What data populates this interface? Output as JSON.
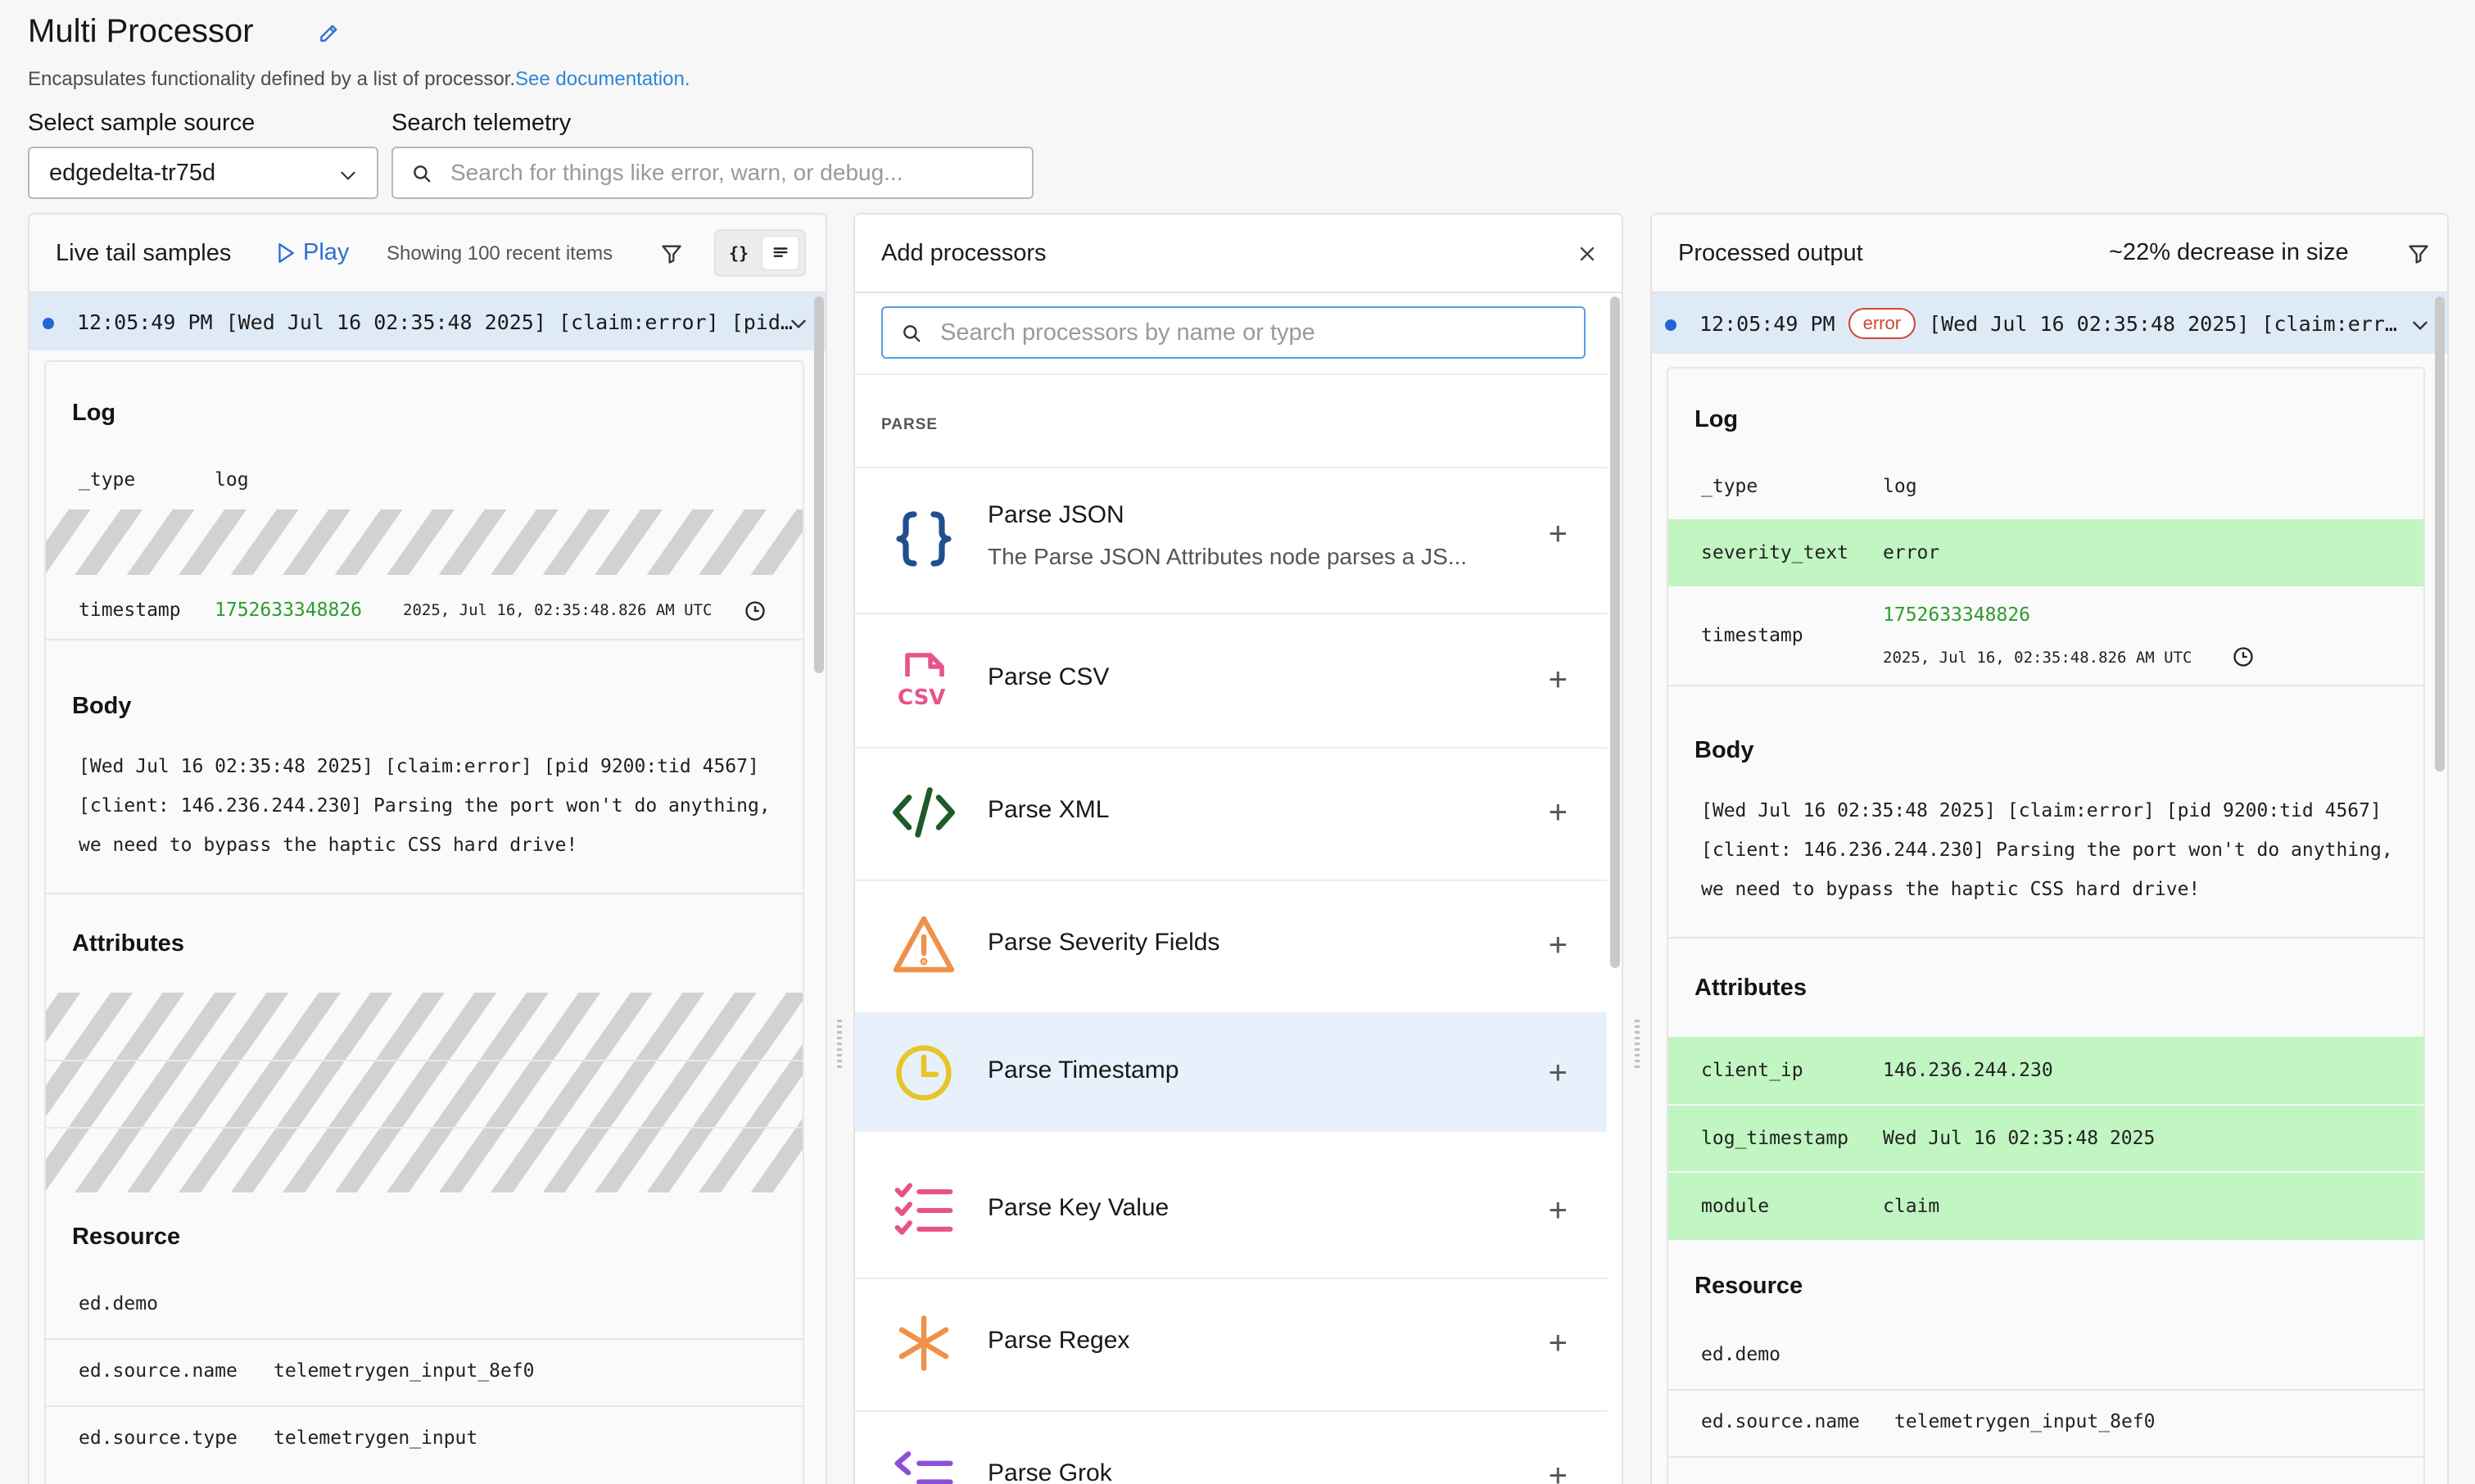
{
  "header": {
    "title": "Multi Processor",
    "description": "Encapsulates functionality defined by a list of processor.",
    "doc_link": "See documentation.",
    "sample_source_label": "Select sample source",
    "sample_source_value": "edgedelta-tr75d",
    "search_label": "Search telemetry",
    "search_placeholder": "Search for things like error, warn, or debug..."
  },
  "left": {
    "title": "Live tail samples",
    "play": "Play",
    "showing": "Showing 100 recent items",
    "json_toggle": "{}",
    "sample": {
      "time": "12:05:49 PM",
      "summary": "[Wed Jul 16 02:35:48 2025] [claim:error] [pid…"
    },
    "log_title": "Log",
    "type_key": "_type",
    "type_value": "log",
    "timestamp_key": "timestamp",
    "timestamp_value": "1752633348826",
    "timestamp_human": "2025, Jul 16, 02:35:48.826 AM UTC",
    "body_title": "Body",
    "body_text": "[Wed Jul 16 02:35:48 2025] [claim:error] [pid 9200:tid 4567] [client: 146.236.244.230] Parsing the port won't do anything, we need to bypass the haptic CSS hard drive!",
    "attributes_title": "Attributes",
    "resource_title": "Resource",
    "resource": [
      {
        "key": "ed.demo",
        "value": ""
      },
      {
        "key": "ed.source.name",
        "value": "telemetrygen_input_8ef0"
      },
      {
        "key": "ed.source.type",
        "value": "telemetrygen_input"
      }
    ]
  },
  "middle": {
    "title": "Add processors",
    "search_placeholder": "Search processors by name or type",
    "section": "PARSE",
    "processors": [
      {
        "name": "Parse JSON",
        "desc": "The Parse JSON Attributes node parses a JS...",
        "icon": "braces-icon",
        "color": "#1f4f8f"
      },
      {
        "name": "Parse CSV",
        "icon": "csv-icon",
        "color": "#e8528a"
      },
      {
        "name": "Parse XML",
        "icon": "code-icon",
        "color": "#1d5b2a"
      },
      {
        "name": "Parse Severity Fields",
        "icon": "warning-icon",
        "color": "#f0914a"
      },
      {
        "name": "Parse Timestamp",
        "icon": "clock-icon",
        "color": "#e6c52a"
      },
      {
        "name": "Parse Key Value",
        "icon": "checklist-icon",
        "color": "#e8528a"
      },
      {
        "name": "Parse Regex",
        "icon": "asterisk-icon",
        "color": "#f0914a"
      },
      {
        "name": "Parse Grok",
        "icon": "list-arrow-icon",
        "color": "#8b4fd6"
      }
    ]
  },
  "right": {
    "title": "Processed output",
    "decrease": "~22% decrease in size",
    "sample": {
      "time": "12:05:49 PM",
      "badge": "error",
      "summary": "[Wed Jul 16 02:35:48 2025] [claim:err…"
    },
    "log_title": "Log",
    "type_key": "_type",
    "type_value": "log",
    "severity_key": "severity_text",
    "severity_value": "error",
    "timestamp_key": "timestamp",
    "timestamp_value": "1752633348826",
    "timestamp_human": "2025, Jul 16, 02:35:48.826 AM UTC",
    "body_title": "Body",
    "body_text": "[Wed Jul 16 02:35:48 2025] [claim:error] [pid 9200:tid 4567] [client: 146.236.244.230] Parsing the port won't do anything, we need to bypass the haptic CSS hard drive!",
    "attributes_title": "Attributes",
    "attributes": [
      {
        "key": "client_ip",
        "value": "146.236.244.230"
      },
      {
        "key": "log_timestamp",
        "value": "Wed Jul 16 02:35:48 2025"
      },
      {
        "key": "module",
        "value": "claim"
      }
    ],
    "resource_title": "Resource",
    "resource": [
      {
        "key": "ed.demo",
        "value": ""
      },
      {
        "key": "ed.source.name",
        "value": "telemetrygen_input_8ef0"
      }
    ]
  },
  "colors": {
    "accent": "#2f86d8",
    "highlight_green": "#c1f5c2",
    "selected_row": "#dfeaf7",
    "error_badge": "#d0462f"
  }
}
